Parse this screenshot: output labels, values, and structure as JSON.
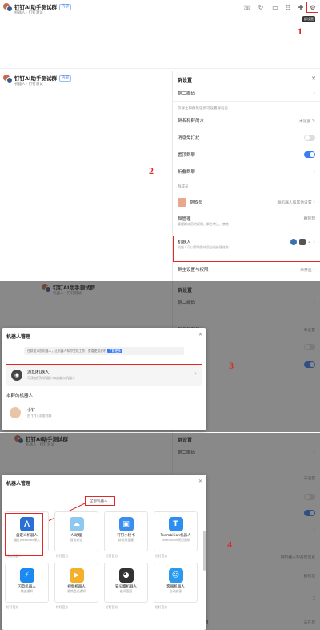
{
  "group": {
    "title": "钉钉AI助手测试群",
    "tag": "内部",
    "subtitle": "机器人 · 钉钉测试"
  },
  "tooltip": "群设置",
  "steps": [
    "1",
    "2",
    "3",
    "4"
  ],
  "settings": {
    "title": "群设置",
    "close": "✕",
    "group_name_label": "群二维码",
    "section_notice": "仅群主和群管理员可设置群信息",
    "remark_label": "群名和群简介",
    "remark_value": "未设置",
    "mute_label": "消息免打扰",
    "pin_label": "置顶群聊",
    "fold_label": "折叠群聊",
    "section_members": "群成员",
    "member_name": "群成员",
    "member_action": "群机器人和其他设置",
    "mgmt_label": "群管理",
    "mgmt_desc": "管理群成员的权限、群主转让、禁言",
    "mgmt_value": "群管理",
    "robot_label": "机器人",
    "robot_desc": "机器人可以帮助群成员自动处理任务",
    "robot_count": "2",
    "more_label": "群主设置与权限",
    "more_value": "未开启"
  },
  "robot_modal": {
    "title": "机器人管理",
    "close": "✕",
    "notice": "在群里添加机器人，让机器人帮你完成工作，查看使用说明",
    "notice_link": "了解更多",
    "add_title": "添加机器人",
    "add_desc": "可添加钉钉机器人和自定义机器人",
    "existing_label": "本群的机器人",
    "existing_name": "小钉",
    "existing_desc": "由 钉钉 添加到群"
  },
  "robot_list": {
    "title": "机器人管理",
    "close": "✕",
    "filter_label": "全部机器人",
    "cards": [
      {
        "name": "自定义机器人",
        "desc": "通过Webhook接入",
        "icon": "webhook-icon",
        "color": "#2a6fd6",
        "foot": "添加机器人"
      },
      {
        "name": "AI助理",
        "desc": "智能对话",
        "icon": "cloud-icon",
        "color": "#8ec8f0",
        "foot": "钉钉官方"
      },
      {
        "name": "钉钉小秘书",
        "desc": "群消息提醒",
        "icon": "chat-icon",
        "color": "#3a8ef0",
        "foot": "钉钉官方"
      },
      {
        "name": "Teambition机器人",
        "desc": "Teambition项目通知",
        "icon": "teambition-icon",
        "color": "#2a8ff0",
        "foot": "钉钉官方"
      },
      {
        "name": "闪电机器人",
        "desc": "快速通知",
        "icon": "bolt-icon",
        "color": "#1a8af0",
        "foot": "钉钉官方"
      },
      {
        "name": "视频机器人",
        "desc": "视频会议通知",
        "icon": "video-icon",
        "color": "#f4b02a",
        "foot": "钉钉官方"
      },
      {
        "name": "猫头鹰机器人",
        "desc": "夜间值班",
        "icon": "owl-icon",
        "color": "#333333",
        "foot": "钉钉官方"
      },
      {
        "name": "客服机器人",
        "desc": "自动应答",
        "icon": "robot-face-icon",
        "color": "#2a9af0",
        "foot": "钉钉官方"
      }
    ]
  }
}
